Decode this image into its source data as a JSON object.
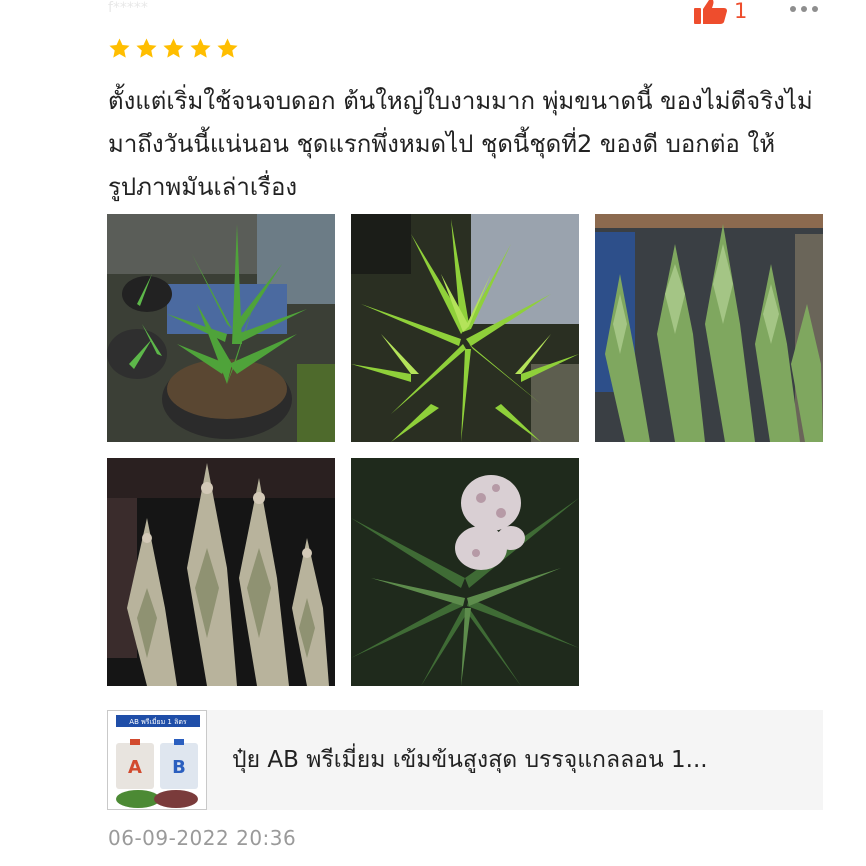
{
  "header": {
    "reviewer_name": "f*****",
    "like_count": "1",
    "accent_color": "#ee4d2d",
    "icons": [
      "thumbs-up-icon",
      "more-options-icon"
    ]
  },
  "review": {
    "rating": 5,
    "star_color": "#ffbe00",
    "text": "ตั้งแต่เริ่มใช้จนจบดอก ต้นใหญ่ใบงามมาก พุ่มขนาดนี้ ของไม่ดีจริงไม่มาถึงวันนี้แน่นอน ชุดแรกพึ่งหมดไป ชุดนี้ชุดที่2 ของดี บอกต่อ ให้รูปภาพมันเล่าเรื่อง",
    "photos": [
      {
        "name": "review-photo-1",
        "subject": "young cannabis plant in pot"
      },
      {
        "name": "review-photo-2",
        "subject": "bright green leaves closeup"
      },
      {
        "name": "review-photo-3",
        "subject": "tall plants under lights"
      },
      {
        "name": "review-photo-4",
        "subject": "flowering plants dark background"
      },
      {
        "name": "review-photo-5",
        "subject": "flower bud with leaves at night"
      }
    ]
  },
  "product": {
    "name": "ปุ๋ย AB พรีเมี่ยม เข้มข้นสูงสุด บรรจุแกลลอน 1...",
    "thumb_title": "AB พรีเมี่ยม 1 ลิตร"
  },
  "timestamp": "06-09-2022 20:36"
}
